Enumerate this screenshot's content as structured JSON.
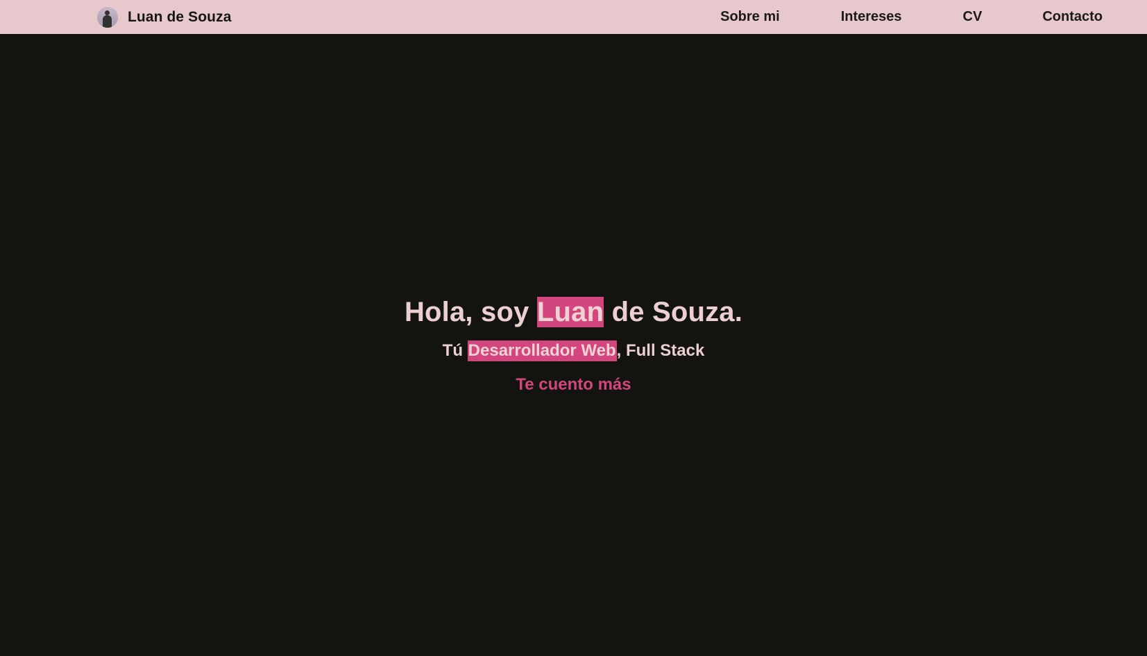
{
  "header": {
    "brand_name": "Luan de Souza",
    "avatar_icon": "avatar-icon",
    "nav": {
      "sobre_mi": "Sobre mi",
      "intereses": "Intereses",
      "cv": "CV",
      "contacto": "Contacto"
    }
  },
  "hero": {
    "title_before": "Hola, soy ",
    "title_highlight": "Luan",
    "title_after": " de Souza.",
    "subtitle_before": "Tú ",
    "subtitle_highlight": "Desarrollador Web",
    "subtitle_after": ", Full Stack",
    "cta": "Te cuento más"
  },
  "colors": {
    "background": "#13140f",
    "navbar": "#e7c8cc",
    "accent": "#d2467d",
    "text_light": "#ecd0d1",
    "text_dark": "#151514"
  }
}
